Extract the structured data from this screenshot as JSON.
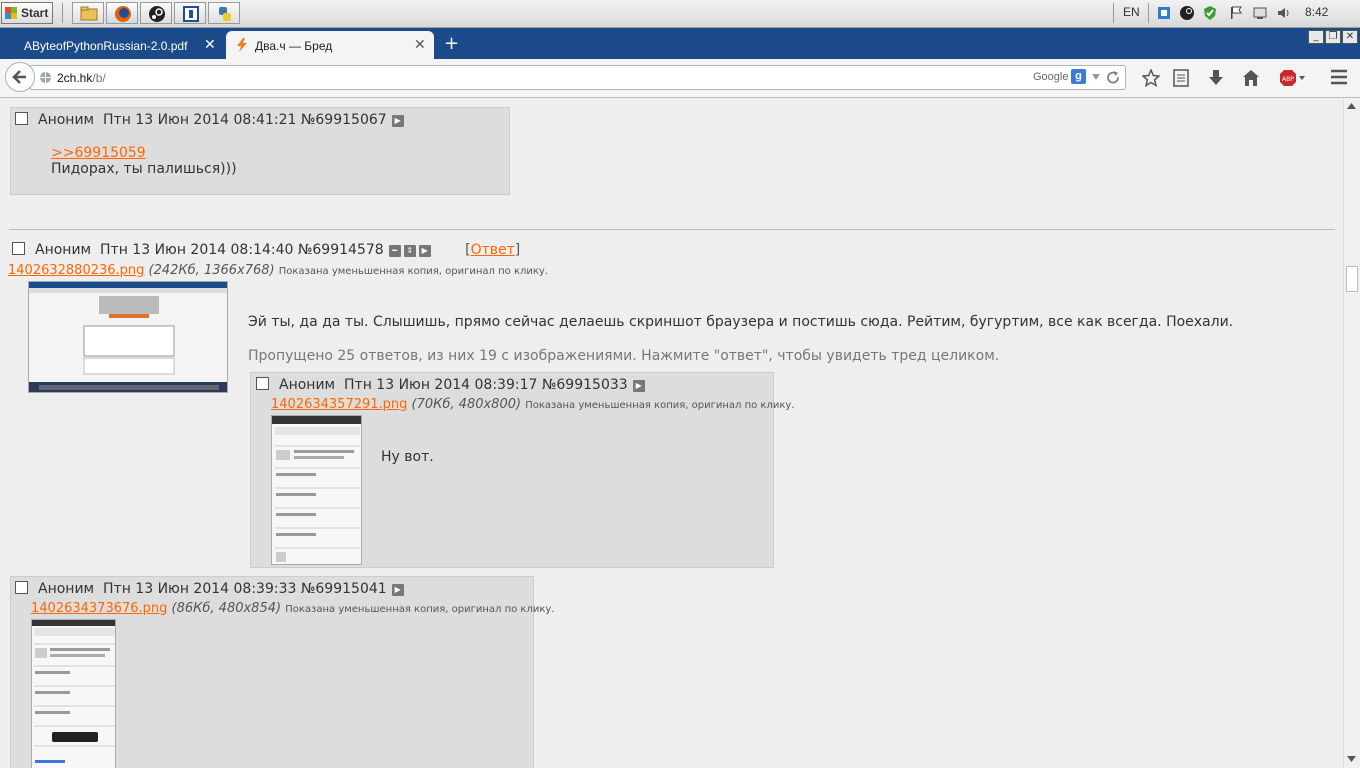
{
  "taskbar": {
    "start_label": "Start",
    "language": "EN",
    "clock": "8:42"
  },
  "browser": {
    "tabs": [
      {
        "label": "AByteofPythonRussian-2.0.pdf"
      },
      {
        "label": "Два.ч — Бред"
      }
    ],
    "url_host": "2ch.hk",
    "url_path": "/b/",
    "search_engine": "Google"
  },
  "thread": {
    "posts": [
      {
        "author": "Аноним",
        "date": "Птн 13 Июн 2014 08:41:21",
        "number": "№69915067",
        "reply_link": ">>69915059",
        "text": "Пидорах, ты палишься)))"
      },
      {
        "author": "Аноним",
        "date": "Птн 13 Июн 2014 08:14:40",
        "number": "№69914578",
        "reply_label": "Ответ",
        "bracket_open": "[",
        "bracket_close": "]",
        "file_name": "1402632880236.png",
        "file_meta": "(242Кб, 1366x768)",
        "file_hint": "Показана уменьшенная копия, оригинал по клику.",
        "text": "Эй ты, да да ты. Слышишь, прямо сейчас делаешь скриншот браузера и постишь сюда. Рейтим, бугуртим, все как всегда. Поехали.",
        "omitted": "Пропущено 25 ответов, из них 19 с изображениями. Нажмите \"ответ\", чтобы увидеть тред целиком."
      },
      {
        "author": "Аноним",
        "date": "Птн 13 Июн 2014 08:39:17",
        "number": "№69915033",
        "file_name": "1402634357291.png",
        "file_meta": "(70Кб, 480x800)",
        "file_hint": "Показана уменьшенная копия, оригинал по клику.",
        "text": "Ну вот."
      },
      {
        "author": "Аноним",
        "date": "Птн 13 Июн 2014 08:39:33",
        "number": "№69915041",
        "file_name": "1402634373676.png",
        "file_meta": "(86Кб, 480x854)",
        "file_hint": "Показана уменьшенная копия, оригинал по клику."
      }
    ]
  },
  "colors": {
    "link": "#ff6600",
    "post_bg": "#dddddd",
    "page_bg": "#eeeeee",
    "tabstrip": "#1c4b8c"
  }
}
